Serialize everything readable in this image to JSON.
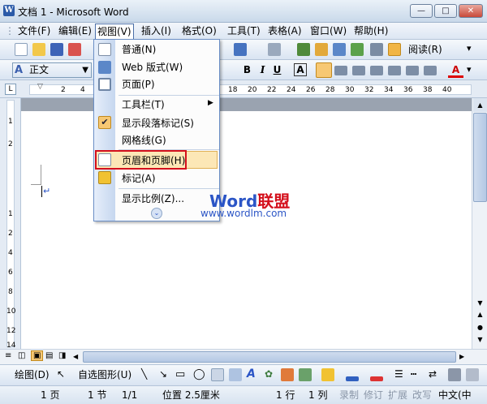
{
  "window": {
    "title": "文档 1 - Microsoft Word"
  },
  "menubar": {
    "items": [
      "文件(F)",
      "编辑(E)",
      "视图(V)",
      "插入(I)",
      "格式(O)",
      "工具(T)",
      "表格(A)",
      "窗口(W)",
      "帮助(H)"
    ]
  },
  "toolbar": {
    "read_label": "阅读(R)"
  },
  "format": {
    "style_value": "正文",
    "bold": "B",
    "italic": "I",
    "underline": "U",
    "char_border": "A",
    "font_color": "A"
  },
  "ruler": {
    "numbers": [
      "2",
      "4",
      "18",
      "20",
      "22",
      "24",
      "26",
      "28",
      "30",
      "32",
      "34",
      "36",
      "38",
      "40"
    ]
  },
  "vruler": {
    "numbers": [
      "1",
      "2",
      "1",
      "2",
      "4",
      "6",
      "8",
      "10",
      "12",
      "14"
    ]
  },
  "view_menu": {
    "items": [
      {
        "label": "普通(N)"
      },
      {
        "label": "Web 版式(W)"
      },
      {
        "label": "页面(P)"
      },
      {
        "label": "工具栏(T)"
      },
      {
        "label": "显示段落标记(S)"
      },
      {
        "label": "网格线(G)"
      },
      {
        "label": "页眉和页脚(H)"
      },
      {
        "label": "标记(A)"
      },
      {
        "label": "显示比例(Z)..."
      }
    ]
  },
  "watermark": {
    "word": "Word",
    "cn": "联盟",
    "url": "www.wordlm.com"
  },
  "drawing": {
    "draw_label": "绘图(D)",
    "autoshapes_label": "自选图形(U)"
  },
  "status": {
    "page": "1 页",
    "section": "1 节",
    "pages": "1/1",
    "position": "位置 2.5厘米",
    "line": "1 行",
    "col": "1 列",
    "record": "录制",
    "revision": "修订",
    "extend": "扩展",
    "overtype": "改写",
    "language": "中文(中"
  },
  "colors": {
    "accent": "#2b55c6",
    "highlight": "#fce7b6",
    "redbox": "#d4101c"
  }
}
